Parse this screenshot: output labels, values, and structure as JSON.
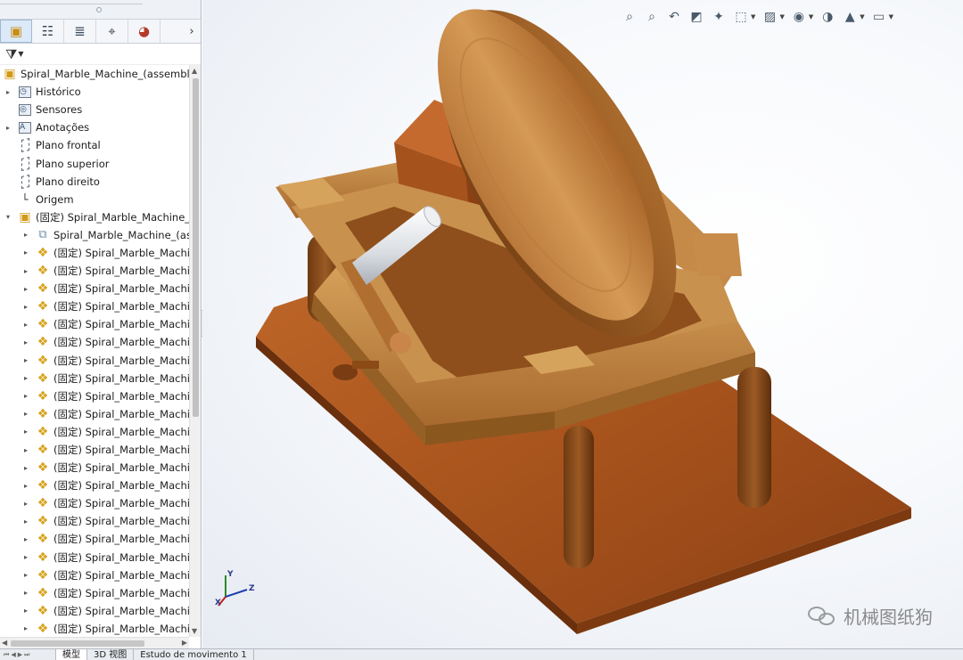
{
  "feature_manager": {
    "tabs": [
      {
        "name": "featuremanager-tab",
        "icon": "assembly-icon",
        "glyph": "▣"
      },
      {
        "name": "propertymanager-tab",
        "icon": "property-list-icon",
        "glyph": "☷"
      },
      {
        "name": "configurationmanager-tab",
        "icon": "configuration-icon",
        "glyph": "≣"
      },
      {
        "name": "dimxpert-tab",
        "icon": "crosshair-icon",
        "glyph": "⌖"
      },
      {
        "name": "displaymanager-tab",
        "icon": "appearance-icon",
        "glyph": "◕"
      }
    ],
    "tab_scroll_glyph": "›",
    "filter_glyph": "⧩",
    "tree": {
      "root": {
        "label": "Spiral_Marble_Machine_(assembly)",
        "icon": "assembly-icon",
        "glyph": "▣"
      },
      "items": [
        {
          "label": "Histórico",
          "icon": "history-folder-icon",
          "expandable": true,
          "indent": 1,
          "glyph": "◷"
        },
        {
          "label": "Sensores",
          "icon": "sensor-folder-icon",
          "expandable": false,
          "indent": 1,
          "glyph": "◎"
        },
        {
          "label": "Anotações",
          "icon": "annotations-folder-icon",
          "expandable": true,
          "indent": 1,
          "glyph": "A"
        },
        {
          "label": "Plano frontal",
          "icon": "plane-icon",
          "expandable": false,
          "indent": 1,
          "glyph": ""
        },
        {
          "label": "Plano superior",
          "icon": "plane-icon",
          "expandable": false,
          "indent": 1,
          "glyph": ""
        },
        {
          "label": "Plano direito",
          "icon": "plane-icon",
          "expandable": false,
          "indent": 1,
          "glyph": ""
        },
        {
          "label": "Origem",
          "icon": "origin-icon",
          "expandable": false,
          "indent": 1,
          "glyph": "└"
        },
        {
          "label": "(固定) Spiral_Marble_Machine_(a",
          "icon": "subassembly-icon",
          "expandable": true,
          "expanded": true,
          "indent": 1,
          "glyph": "▣"
        },
        {
          "label": "Spiral_Marble_Machine_(ass",
          "icon": "mates-folder-icon",
          "expandable": true,
          "indent": 2,
          "glyph": "⧉"
        },
        {
          "label": "(固定) Spiral_Marble_Machin",
          "icon": "part-icon",
          "expandable": true,
          "indent": 2,
          "glyph": "❖"
        },
        {
          "label": "(固定) Spiral_Marble_Machin",
          "icon": "part-icon",
          "expandable": true,
          "indent": 2,
          "glyph": "❖"
        },
        {
          "label": "(固定) Spiral_Marble_Machin",
          "icon": "part-icon",
          "expandable": true,
          "indent": 2,
          "glyph": "❖"
        },
        {
          "label": "(固定) Spiral_Marble_Machin",
          "icon": "part-icon",
          "expandable": true,
          "indent": 2,
          "glyph": "❖"
        },
        {
          "label": "(固定) Spiral_Marble_Machin",
          "icon": "part-icon",
          "expandable": true,
          "indent": 2,
          "glyph": "❖"
        },
        {
          "label": "(固定) Spiral_Marble_Machin",
          "icon": "part-icon",
          "expandable": true,
          "indent": 2,
          "glyph": "❖"
        },
        {
          "label": "(固定) Spiral_Marble_Machin",
          "icon": "part-icon",
          "expandable": true,
          "indent": 2,
          "glyph": "❖"
        },
        {
          "label": "(固定) Spiral_Marble_Machin",
          "icon": "part-icon",
          "expandable": true,
          "indent": 2,
          "glyph": "❖"
        },
        {
          "label": "(固定) Spiral_Marble_Machin",
          "icon": "part-icon",
          "expandable": true,
          "indent": 2,
          "glyph": "❖"
        },
        {
          "label": "(固定) Spiral_Marble_Machin",
          "icon": "part-icon",
          "expandable": true,
          "indent": 2,
          "glyph": "❖"
        },
        {
          "label": "(固定) Spiral_Marble_Machin",
          "icon": "part-icon",
          "expandable": true,
          "indent": 2,
          "glyph": "❖"
        },
        {
          "label": "(固定) Spiral_Marble_Machin",
          "icon": "part-icon",
          "expandable": true,
          "indent": 2,
          "glyph": "❖"
        },
        {
          "label": "(固定) Spiral_Marble_Machin",
          "icon": "part-icon",
          "expandable": true,
          "indent": 2,
          "glyph": "❖"
        },
        {
          "label": "(固定) Spiral_Marble_Machin",
          "icon": "part-icon",
          "expandable": true,
          "indent": 2,
          "glyph": "❖"
        },
        {
          "label": "(固定) Spiral_Marble_Machin",
          "icon": "part-icon",
          "expandable": true,
          "indent": 2,
          "glyph": "❖"
        },
        {
          "label": "(固定) Spiral_Marble_Machin",
          "icon": "part-icon",
          "expandable": true,
          "indent": 2,
          "glyph": "❖"
        },
        {
          "label": "(固定) Spiral_Marble_Machin",
          "icon": "part-icon",
          "expandable": true,
          "indent": 2,
          "glyph": "❖"
        },
        {
          "label": "(固定) Spiral_Marble_Machin",
          "icon": "part-icon",
          "expandable": true,
          "indent": 2,
          "glyph": "❖"
        },
        {
          "label": "(固定) Spiral_Marble_Machin",
          "icon": "part-icon",
          "expandable": true,
          "indent": 2,
          "glyph": "❖"
        },
        {
          "label": "(固定) Spiral_Marble_Machin",
          "icon": "part-icon",
          "expandable": true,
          "indent": 2,
          "glyph": "❖"
        },
        {
          "label": "(固定) Spiral_Marble_Machin",
          "icon": "part-icon",
          "expandable": true,
          "indent": 2,
          "glyph": "❖"
        },
        {
          "label": "(固定) Spiral_Marble_Machin",
          "icon": "part-icon",
          "expandable": true,
          "indent": 2,
          "glyph": "❖"
        }
      ]
    }
  },
  "heads_up_toolbar": [
    {
      "name": "zoom-to-fit-icon",
      "glyph": "⌕",
      "caret": false
    },
    {
      "name": "zoom-to-area-icon",
      "glyph": "⌕",
      "caret": false
    },
    {
      "name": "previous-view-icon",
      "glyph": "↶",
      "caret": false
    },
    {
      "name": "section-view-icon",
      "glyph": "◩",
      "caret": false
    },
    {
      "name": "dynamic-annotation-icon",
      "glyph": "✦",
      "caret": false
    },
    {
      "name": "view-orientation-icon",
      "glyph": "⬚",
      "caret": true
    },
    {
      "name": "display-style-icon",
      "glyph": "▨",
      "caret": true
    },
    {
      "name": "hide-show-items-icon",
      "glyph": "◉",
      "caret": true
    },
    {
      "name": "edit-appearance-icon",
      "glyph": "◑",
      "caret": false
    },
    {
      "name": "apply-scene-icon",
      "glyph": "▲",
      "caret": true
    },
    {
      "name": "view-settings-icon",
      "glyph": "▭",
      "caret": true
    }
  ],
  "triad": {
    "x": "X",
    "y": "Y",
    "z": "Z"
  },
  "watermark": {
    "text": "机械图纸狗"
  },
  "bottom_tabs": [
    {
      "label": "模型",
      "active": true
    },
    {
      "label": "3D 视图",
      "active": false
    },
    {
      "label": "Estudo de movimento 1",
      "active": false
    }
  ],
  "colors": {
    "accent": "#dce9f8",
    "wood_light": "#d39a4c",
    "wood_dark": "#8a4d18",
    "base_wood": "#b05a22",
    "viewport_bg": "#eef2f7"
  }
}
